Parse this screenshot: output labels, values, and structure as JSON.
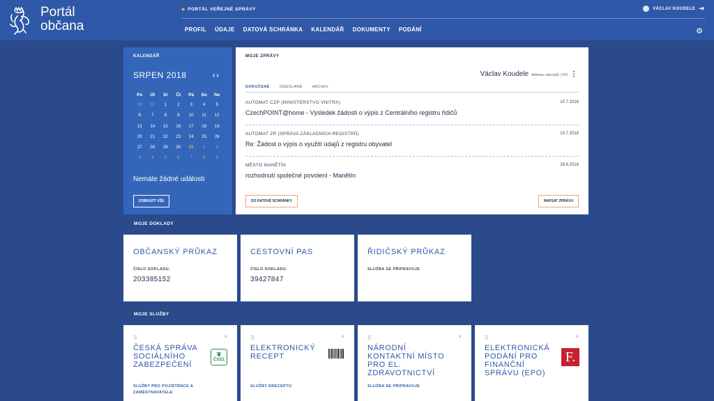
{
  "header": {
    "logo_line1": "Portál",
    "logo_line2": "občana",
    "top_link": "PORTÁL VEŘEJNÉ SPRÁVY",
    "nav": [
      "PROFIL",
      "ÚDAJE",
      "DATOVÁ SCHRÁNKA",
      "KALENDÁŘ",
      "DOKUMENTY",
      "PODÁNÍ"
    ],
    "user_name": "VÁCLAV KOUDELE",
    "icons": {
      "logo": "lion-emblem-icon",
      "user": "avatar-icon",
      "logout": "logout-icon",
      "settings": "gear-icon"
    }
  },
  "calendar": {
    "label": "KALENDÁŘ",
    "month": "SRPEN 2018",
    "prev": "‹",
    "next": "›",
    "weekdays": [
      "Po",
      "Út",
      "St",
      "Čt",
      "Pá",
      "So",
      "Ne"
    ],
    "weeks": [
      [
        "30",
        "31",
        "1",
        "2",
        "3",
        "4",
        "5"
      ],
      [
        "6",
        "7",
        "8",
        "9",
        "10",
        "11",
        "12"
      ],
      [
        "13",
        "14",
        "15",
        "16",
        "17",
        "18",
        "19"
      ],
      [
        "20",
        "21",
        "22",
        "23",
        "24",
        "25",
        "26"
      ],
      [
        "27",
        "28",
        "29",
        "30",
        "31",
        "1",
        "2"
      ],
      [
        "3",
        "4",
        "5",
        "6",
        "7",
        "8",
        "9"
      ]
    ],
    "no_events": "Nemáte žádné události",
    "show_all": "ZOBRAZIT VŠE"
  },
  "messages": {
    "label": "MOJE ZPRÁVY",
    "user_name": "Václav Koudele",
    "address": "Adresa: ekcca3r | FO",
    "tabs": [
      "DORUČENÉ",
      "ODESLANÉ",
      "ARCHIV"
    ],
    "items": [
      {
        "from": "AUTOMAT CZP (MINISTERSTVO VNITRA)",
        "date": "10.7.2018",
        "subject": "CzechPOINT@home - Výsledek žádosti o výpis z Centrálního registru řidičů"
      },
      {
        "from": "AUTOMAT ZR (SPRÁVA ZÁKLADNÍCH REGISTRŮ)",
        "date": "10.7.2018",
        "subject": "Re: Žádost o výpis o využití údajů z registru obyvatel"
      },
      {
        "from": "MĚSTO MANĚTÍN",
        "date": "28.6.2018",
        "subject": "rozhodnutí společné povolení - Manětín"
      }
    ],
    "btn_inbox": "DO DATOVÉ SCHRÁNKY",
    "btn_write": "NAPSAT ZPRÁVU"
  },
  "documents": {
    "label": "MOJE DOKLADY",
    "items": [
      {
        "title": "OBČANSKÝ PRŮKAZ",
        "field_label": "ČÍSLO DOKLADU:",
        "value": "203385152"
      },
      {
        "title": "CESTOVNÍ PAS",
        "field_label": "ČÍSLO DOKLADU:",
        "value": "39427847"
      },
      {
        "title": "ŘIDIČSKÝ PRŮKAZ",
        "field_label": "SLUŽBA SE PŘIPRAVUJE",
        "value": ""
      }
    ]
  },
  "services": {
    "label": "MOJE SLUŽBY",
    "items": [
      {
        "title": "ČESKÁ SPRÁVA SOCIÁLNÍHO ZABEZPEČENÍ",
        "sub": "SLUŽBY PRO POJIŠTĚNCE A ZAMĚSTNAVATELE",
        "logo_text": "ČSSZ",
        "logo_icon": "cssz-logo-icon"
      },
      {
        "title": "ELEKTRONICKÝ RECEPT",
        "sub": "SLUŽBY ERECEPTU",
        "logo_icon": "barcode-icon"
      },
      {
        "title": "NÁRODNÍ KONTAKTNÍ MÍSTO PRO EL. ZDRAVOTNICTVÍ",
        "sub": "SLUŽBA SE PŘIPRAVUJE"
      },
      {
        "title": "ELEKTRONICKÁ PODÁNÍ PRO FINANČNÍ SPRÁVU (EPO)",
        "sub": "",
        "logo_text": "F.",
        "logo_icon": "financni-sprava-logo-icon"
      }
    ]
  }
}
